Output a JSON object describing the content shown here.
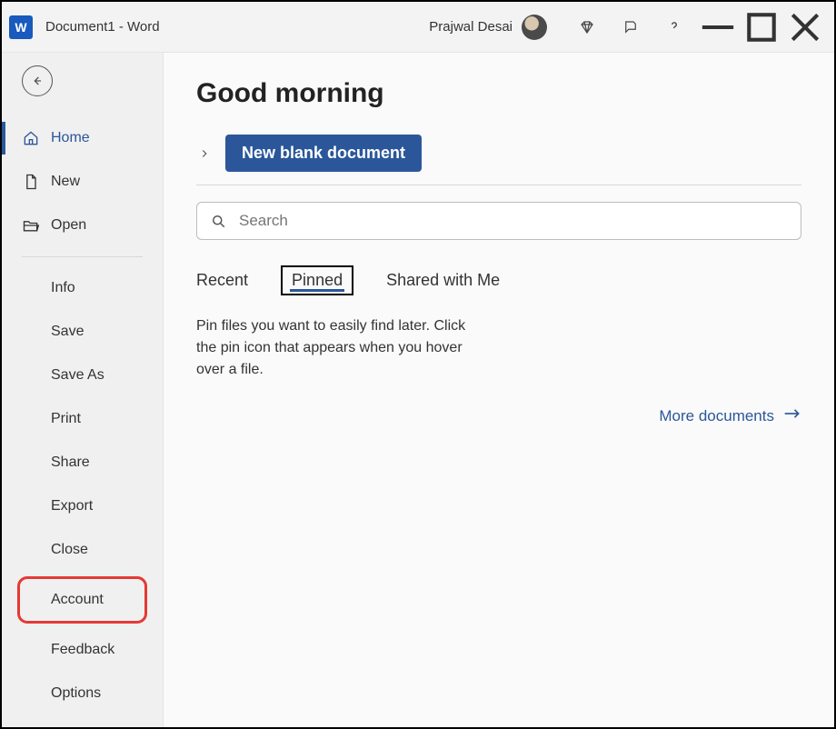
{
  "titlebar": {
    "doc_title": "Document1  -  Word",
    "username": "Prajwal Desai"
  },
  "sidebar": {
    "nav1": [
      {
        "label": "Home",
        "icon": "home"
      },
      {
        "label": "New",
        "icon": "document"
      },
      {
        "label": "Open",
        "icon": "folder"
      }
    ],
    "nav2": [
      {
        "label": "Info"
      },
      {
        "label": "Save"
      },
      {
        "label": "Save As"
      },
      {
        "label": "Print"
      },
      {
        "label": "Share"
      },
      {
        "label": "Export"
      },
      {
        "label": "Close"
      },
      {
        "label": "Account",
        "highlighted": true
      },
      {
        "label": "Feedback"
      },
      {
        "label": "Options"
      }
    ]
  },
  "main": {
    "greeting": "Good morning",
    "new_blank_label": "New blank document",
    "search_placeholder": "Search",
    "tabs": {
      "recent": "Recent",
      "pinned": "Pinned",
      "shared": "Shared with Me",
      "selected": "Pinned"
    },
    "pinned_hint": "Pin files you want to easily find later. Click the pin icon that appears when you hover over a file.",
    "more_documents": "More documents"
  }
}
